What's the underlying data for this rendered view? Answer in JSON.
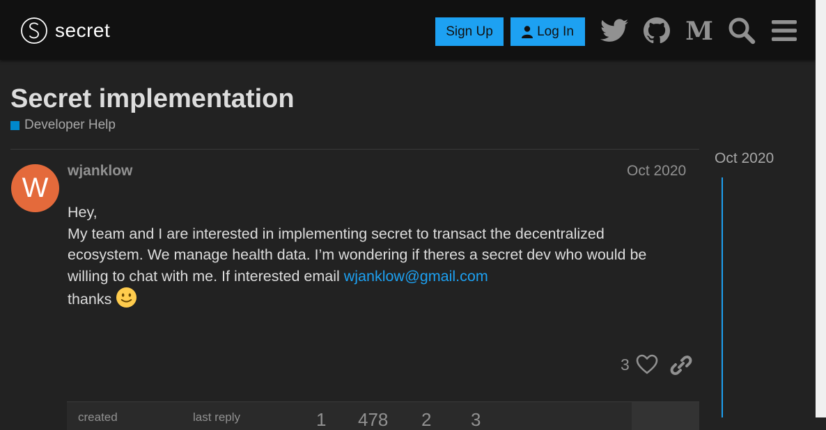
{
  "header": {
    "logo_text": "secret",
    "signup_label": "Sign Up",
    "login_label": "Log In",
    "icons": [
      "twitter-icon",
      "github-icon",
      "medium-icon",
      "search-icon",
      "hamburger-menu-icon"
    ],
    "accent_color": "#1da1f2"
  },
  "topic": {
    "title": "Secret implementation",
    "category": "Developer Help",
    "category_color": "#0088cc"
  },
  "post": {
    "avatar_letter": "W",
    "avatar_color": "#e46a3b",
    "username": "wjanklow",
    "date": "Oct 2020",
    "body_line1": "Hey,",
    "body_line2": "My team and I are interested in implementing secret to transact the decentralized ecosystem. We manage health data. I’m wondering if theres a secret dev who would be willing to chat with me. If interested email ",
    "email": "wjanklow@gmail.com",
    "body_line3": "thanks",
    "like_count": "3"
  },
  "topic_map": {
    "created_label": "created",
    "last_reply_label": "last reply",
    "replies": "1",
    "views": "478",
    "users": "2",
    "likes": "3"
  },
  "timeline": {
    "date": "Oct 2020"
  }
}
